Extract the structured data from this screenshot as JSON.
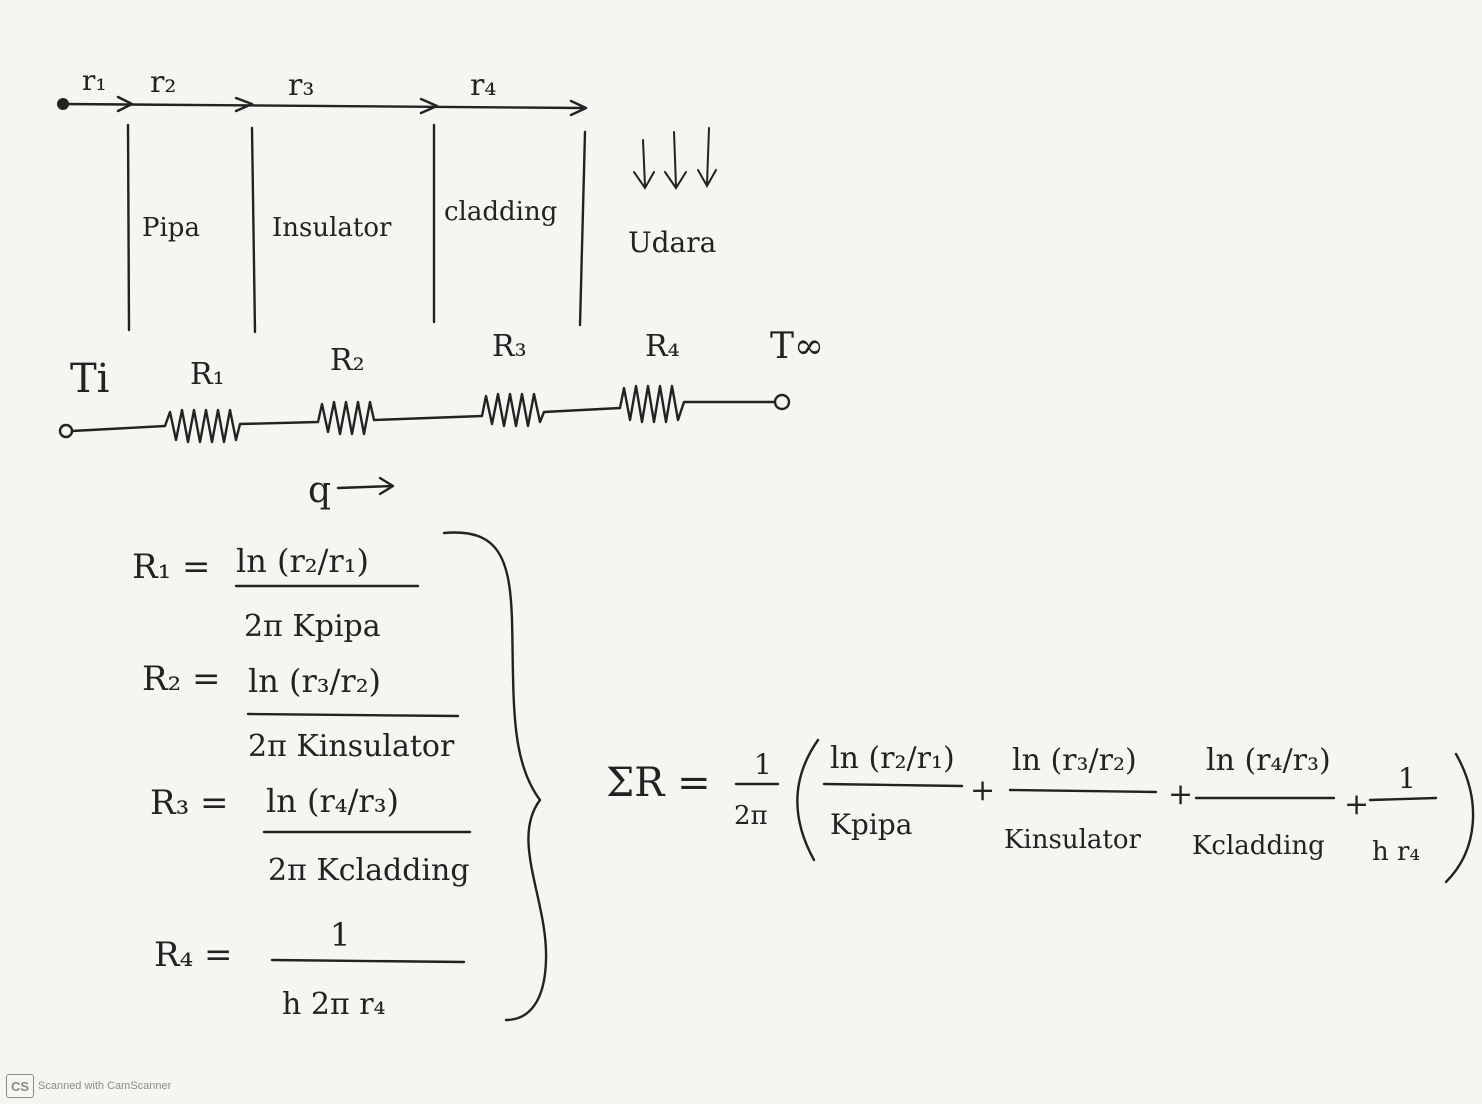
{
  "radii": {
    "r1": "r₁",
    "r2": "r₂",
    "r3": "r₃",
    "r4": "r₄"
  },
  "layers": {
    "pipe": "Pipa",
    "insulator": "Insulator",
    "cladding": "cladding",
    "air": "Udara"
  },
  "circuit": {
    "t_inner": "Ti",
    "t_outer": "T∞",
    "resistors": [
      "R₁",
      "R₂",
      "R₃",
      "R₄"
    ],
    "heat_flow": "q"
  },
  "equations": {
    "r1": {
      "lhs": "R₁ =",
      "num": "ln (r₂/r₁)",
      "den": "2π Kpipa"
    },
    "r2": {
      "lhs": "R₂ =",
      "num": "ln (r₃/r₂)",
      "den": "2π Kinsulator"
    },
    "r3": {
      "lhs": "R₃ =",
      "num": "ln (r₄/r₃)",
      "den": "2π Kcladding"
    },
    "r4": {
      "lhs": "R₄ =",
      "num": "1",
      "den": "h 2π r₄"
    }
  },
  "sum": {
    "lhs": "ΣR =",
    "prefix_num": "1",
    "prefix_den": "2π",
    "terms": [
      {
        "num": "ln (r₂/r₁)",
        "den": "Kpipa"
      },
      {
        "num": "ln (r₃/r₂)",
        "den": "Kinsulator"
      },
      {
        "num": "ln (r₄/r₃)",
        "den": "Kcladding"
      },
      {
        "num": "1",
        "den": "h r₄"
      }
    ],
    "plus": "+"
  },
  "footer": {
    "logo": "CS",
    "text": "Scanned with CamScanner"
  }
}
